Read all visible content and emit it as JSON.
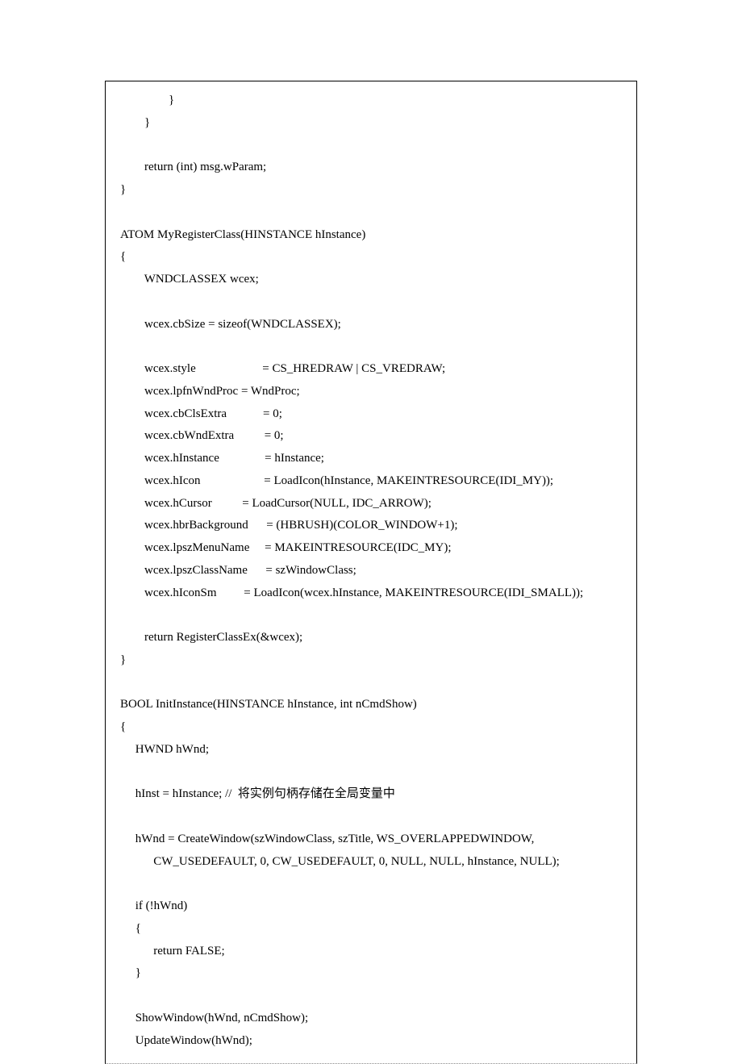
{
  "code": {
    "lines": [
      "                }",
      "        }",
      "",
      "        return (int) msg.wParam;",
      "}",
      "",
      "ATOM MyRegisterClass(HINSTANCE hInstance)",
      "{",
      "        WNDCLASSEX wcex;",
      "",
      "        wcex.cbSize = sizeof(WNDCLASSEX);",
      "",
      "        wcex.style                      = CS_HREDRAW | CS_VREDRAW;",
      "        wcex.lpfnWndProc = WndProc;",
      "        wcex.cbClsExtra            = 0;",
      "        wcex.cbWndExtra          = 0;",
      "        wcex.hInstance               = hInstance;",
      "        wcex.hIcon                     = LoadIcon(hInstance, MAKEINTRESOURCE(IDI_MY));",
      "        wcex.hCursor          = LoadCursor(NULL, IDC_ARROW);",
      "        wcex.hbrBackground      = (HBRUSH)(COLOR_WINDOW+1);",
      "        wcex.lpszMenuName     = MAKEINTRESOURCE(IDC_MY);",
      "        wcex.lpszClassName      = szWindowClass;",
      "        wcex.hIconSm         = LoadIcon(wcex.hInstance, MAKEINTRESOURCE(IDI_SMALL));",
      "",
      "        return RegisterClassEx(&wcex);",
      "}",
      "",
      "BOOL InitInstance(HINSTANCE hInstance, int nCmdShow)",
      "{",
      "     HWND hWnd;",
      "",
      "     hInst = hInstance; //  将实例句柄存储在全局变量中",
      "",
      "     hWnd = CreateWindow(szWindowClass, szTitle, WS_OVERLAPPEDWINDOW,",
      "           CW_USEDEFAULT, 0, CW_USEDEFAULT, 0, NULL, NULL, hInstance, NULL);",
      "",
      "     if (!hWnd)",
      "     {",
      "           return FALSE;",
      "     }",
      "",
      "     ShowWindow(hWnd, nCmdShow);",
      "     UpdateWindow(hWnd);"
    ]
  }
}
